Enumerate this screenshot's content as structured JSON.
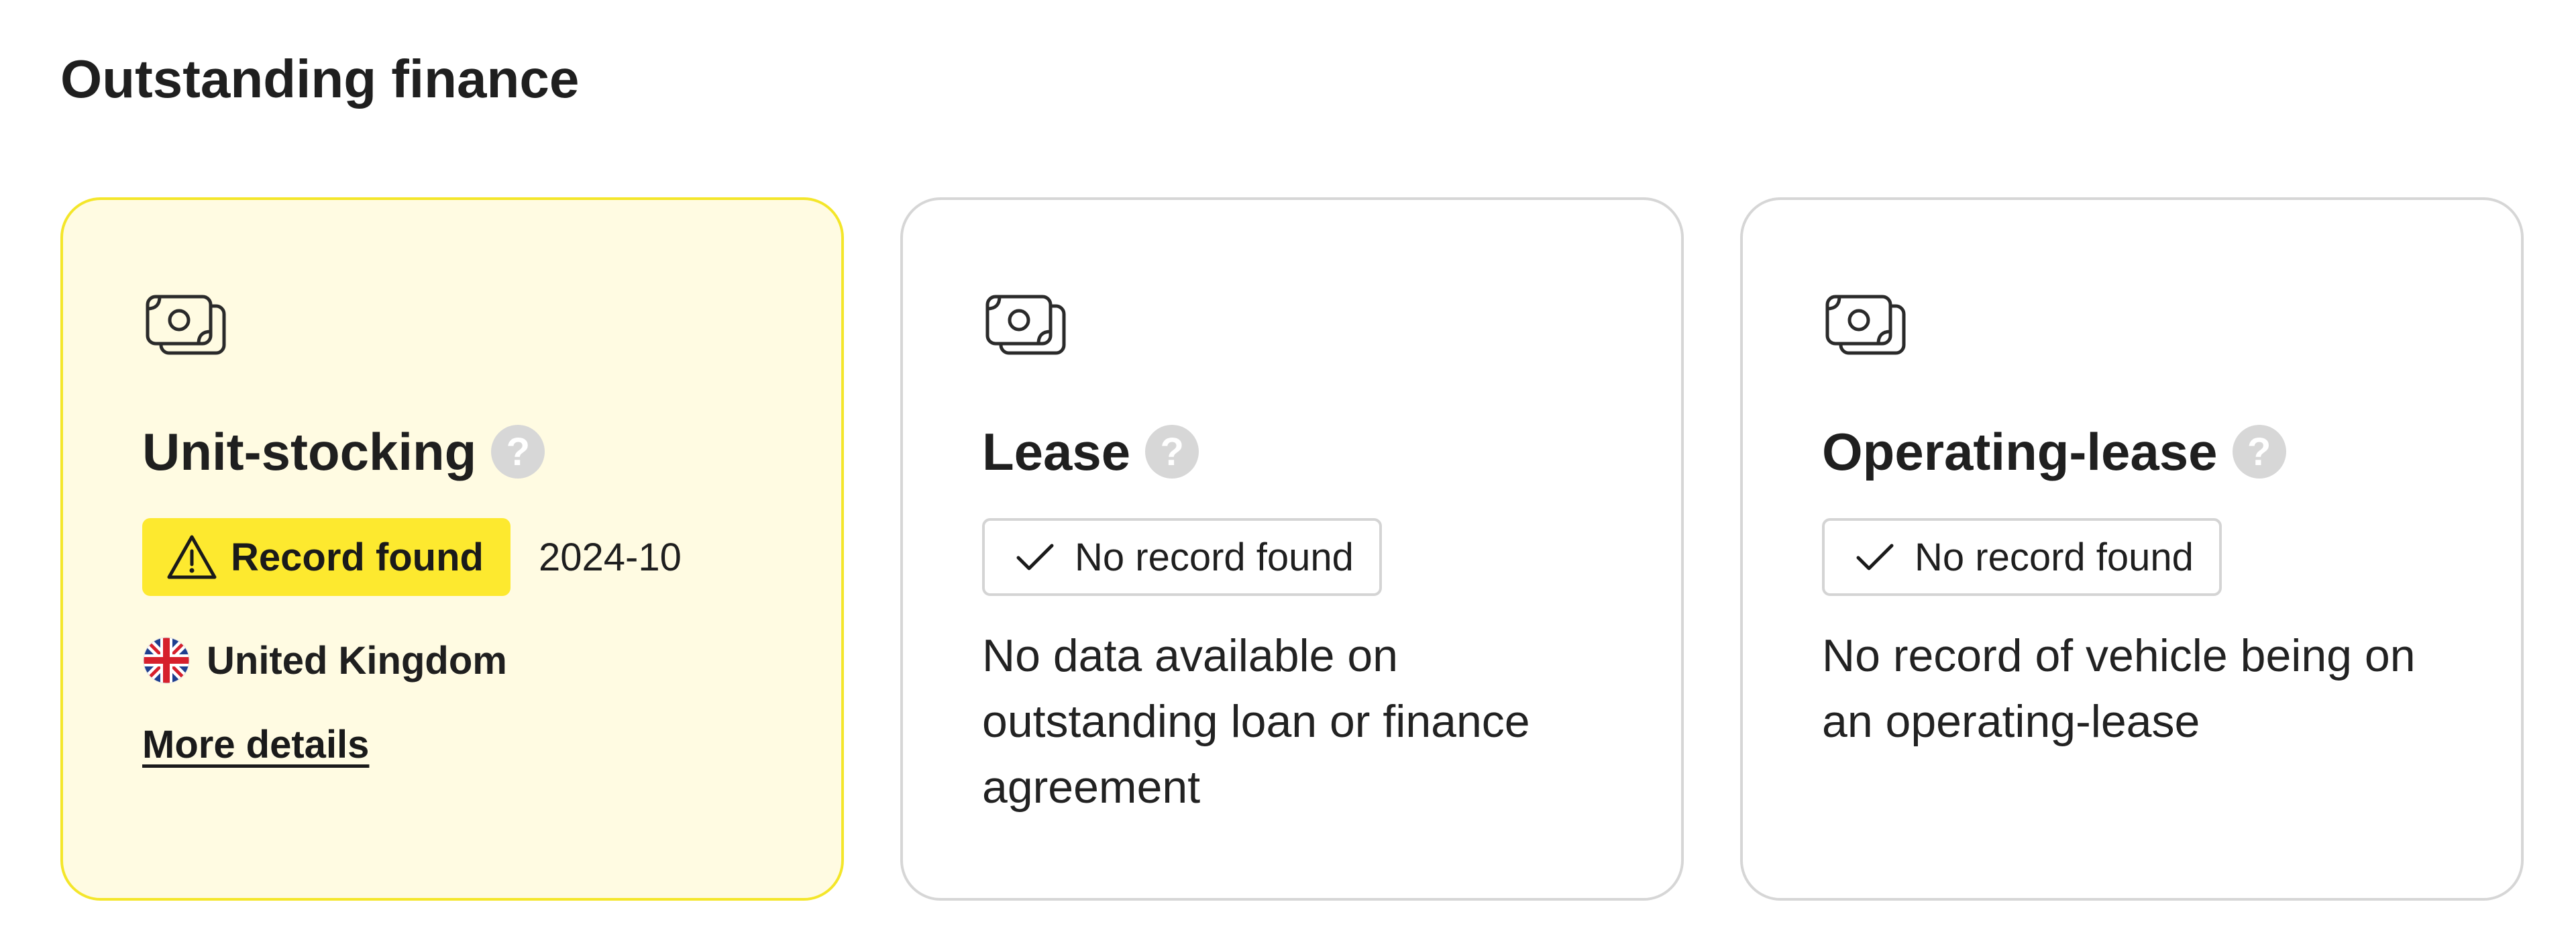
{
  "section": {
    "title": "Outstanding finance"
  },
  "cards": [
    {
      "icon": "money-icon",
      "title": "Unit-stocking",
      "help_icon": "help-icon",
      "help_label": "?",
      "status_label": "Record found",
      "status_icon": "warning-icon",
      "date": "2024-10",
      "country_icon": "uk-flag-icon",
      "country": "United Kingdom",
      "link_label": "More details",
      "accent_background": "#fffbe2",
      "accent_border": "#f4e62a",
      "badge_color": "#fde92f"
    },
    {
      "icon": "money-icon",
      "title": "Lease",
      "help_icon": "help-icon",
      "help_label": "?",
      "status_label": "No record found",
      "status_icon": "check-icon",
      "description": "No data available on outstanding loan or finance agreement"
    },
    {
      "icon": "money-icon",
      "title": "Operating-lease",
      "help_icon": "help-icon",
      "help_label": "?",
      "status_label": "No record found",
      "status_icon": "check-icon",
      "description": "No record of vehicle being on an operating-lease"
    }
  ]
}
